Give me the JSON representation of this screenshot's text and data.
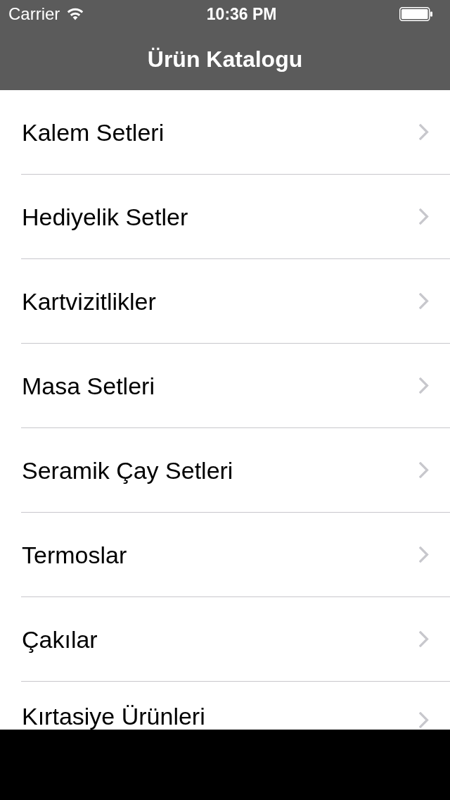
{
  "status_bar": {
    "carrier": "Carrier",
    "time": "10:36 PM"
  },
  "nav_bar": {
    "title": "Ürün Katalogu"
  },
  "list": {
    "items": [
      {
        "label": "Kalem Setleri"
      },
      {
        "label": "Hediyelik Setler"
      },
      {
        "label": "Kartvizitlikler"
      },
      {
        "label": "Masa Setleri"
      },
      {
        "label": "Seramik Çay Setleri"
      },
      {
        "label": "Termoslar"
      },
      {
        "label": "Çakılar"
      },
      {
        "label": "Kırtasiye Ürünleri"
      }
    ]
  }
}
